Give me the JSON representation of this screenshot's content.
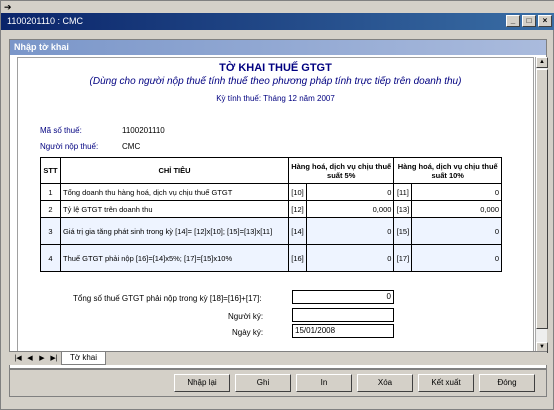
{
  "window": {
    "title": "1100201110 : CMC"
  },
  "child": {
    "title": "Nhập tờ khai"
  },
  "form": {
    "title": "TỜ KHAI THUẾ GTGT",
    "subtitle": "(Dùng cho người nộp thuế tính thuế theo phương pháp tính trực tiếp trên doanh thu)",
    "period": "Kỳ tính thuế: Tháng 12 năm 2007",
    "tax_id_label": "Mã số thuế:",
    "tax_id": "1100201110",
    "payer_label": "Người nộp thuế:",
    "payer": "CMC"
  },
  "table": {
    "headers": {
      "stt": "STT",
      "item": "CHỈ TIÊU",
      "col5": "Hàng hoá, dịch vụ chịu thuế suất 5%",
      "col10": "Hàng hoá, dịch vụ chịu thuế suất 10%"
    },
    "rows": [
      {
        "stt": "1",
        "item": "Tổng doanh thu hàng hoá, dịch vụ chịu thuế GTGT",
        "c1": "[10]",
        "v1": "0",
        "c2": "[11]",
        "v2": "0"
      },
      {
        "stt": "2",
        "item": "Tỷ lệ GTGT trên doanh thu",
        "c1": "[12]",
        "v1": "0,000",
        "c2": "[13]",
        "v2": "0,000"
      },
      {
        "stt": "3",
        "item": "Giá trị gia tăng phát sinh trong kỳ [14]= [12]x[10]; [15]=[13]x[11]",
        "c1": "[14]",
        "v1": "0",
        "c2": "[15]",
        "v2": "0"
      },
      {
        "stt": "4",
        "item": "Thuế GTGT phải nộp [16]=[14]x5%; [17]=[15]x10%",
        "c1": "[16]",
        "v1": "0",
        "c2": "[17]",
        "v2": "0"
      }
    ]
  },
  "summary": {
    "total_label": "Tổng số thuế GTGT phải nộp trong kỳ [18]=[16]+[17]:",
    "total": "0",
    "signer_label": "Người ký:",
    "signer": "",
    "date_label": "Ngày ký:",
    "date": "15/01/2008"
  },
  "tabs": {
    "sheet": "Tờ khai"
  },
  "buttons": {
    "import": "Nhập lại",
    "save": "Ghi",
    "print": "In",
    "delete": "Xóa",
    "export": "Kết xuất",
    "close": "Đóng"
  }
}
